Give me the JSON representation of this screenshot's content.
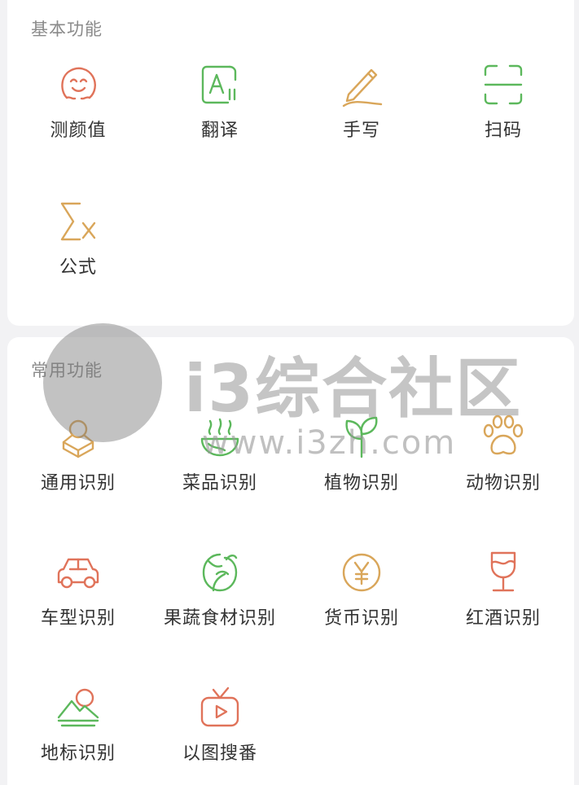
{
  "basic": {
    "title": "基本功能",
    "items": [
      {
        "label": "测颜值",
        "icon": "face-icon"
      },
      {
        "label": "翻译",
        "icon": "translate-icon"
      },
      {
        "label": "手写",
        "icon": "pen-icon"
      },
      {
        "label": "扫码",
        "icon": "scan-icon"
      },
      {
        "label": "公式",
        "icon": "formula-icon"
      }
    ]
  },
  "common": {
    "title": "常用功能",
    "items": [
      {
        "label": "通用识别",
        "icon": "generic-recognition-icon"
      },
      {
        "label": "菜品识别",
        "icon": "dish-icon"
      },
      {
        "label": "植物识别",
        "icon": "plant-icon"
      },
      {
        "label": "动物识别",
        "icon": "paw-icon"
      },
      {
        "label": "车型识别",
        "icon": "car-icon"
      },
      {
        "label": "果蔬食材识别",
        "icon": "vegetable-icon"
      },
      {
        "label": "货币识别",
        "icon": "currency-icon"
      },
      {
        "label": "红酒识别",
        "icon": "wine-icon"
      },
      {
        "label": "地标识别",
        "icon": "landmark-icon"
      },
      {
        "label": "以图搜番",
        "icon": "tv-icon"
      }
    ]
  },
  "watermark": {
    "text": "i3综合社区",
    "url": "www.i3zh.com"
  },
  "colors": {
    "red": "#e0735a",
    "green": "#5cb85c",
    "gold": "#d9a65a"
  }
}
